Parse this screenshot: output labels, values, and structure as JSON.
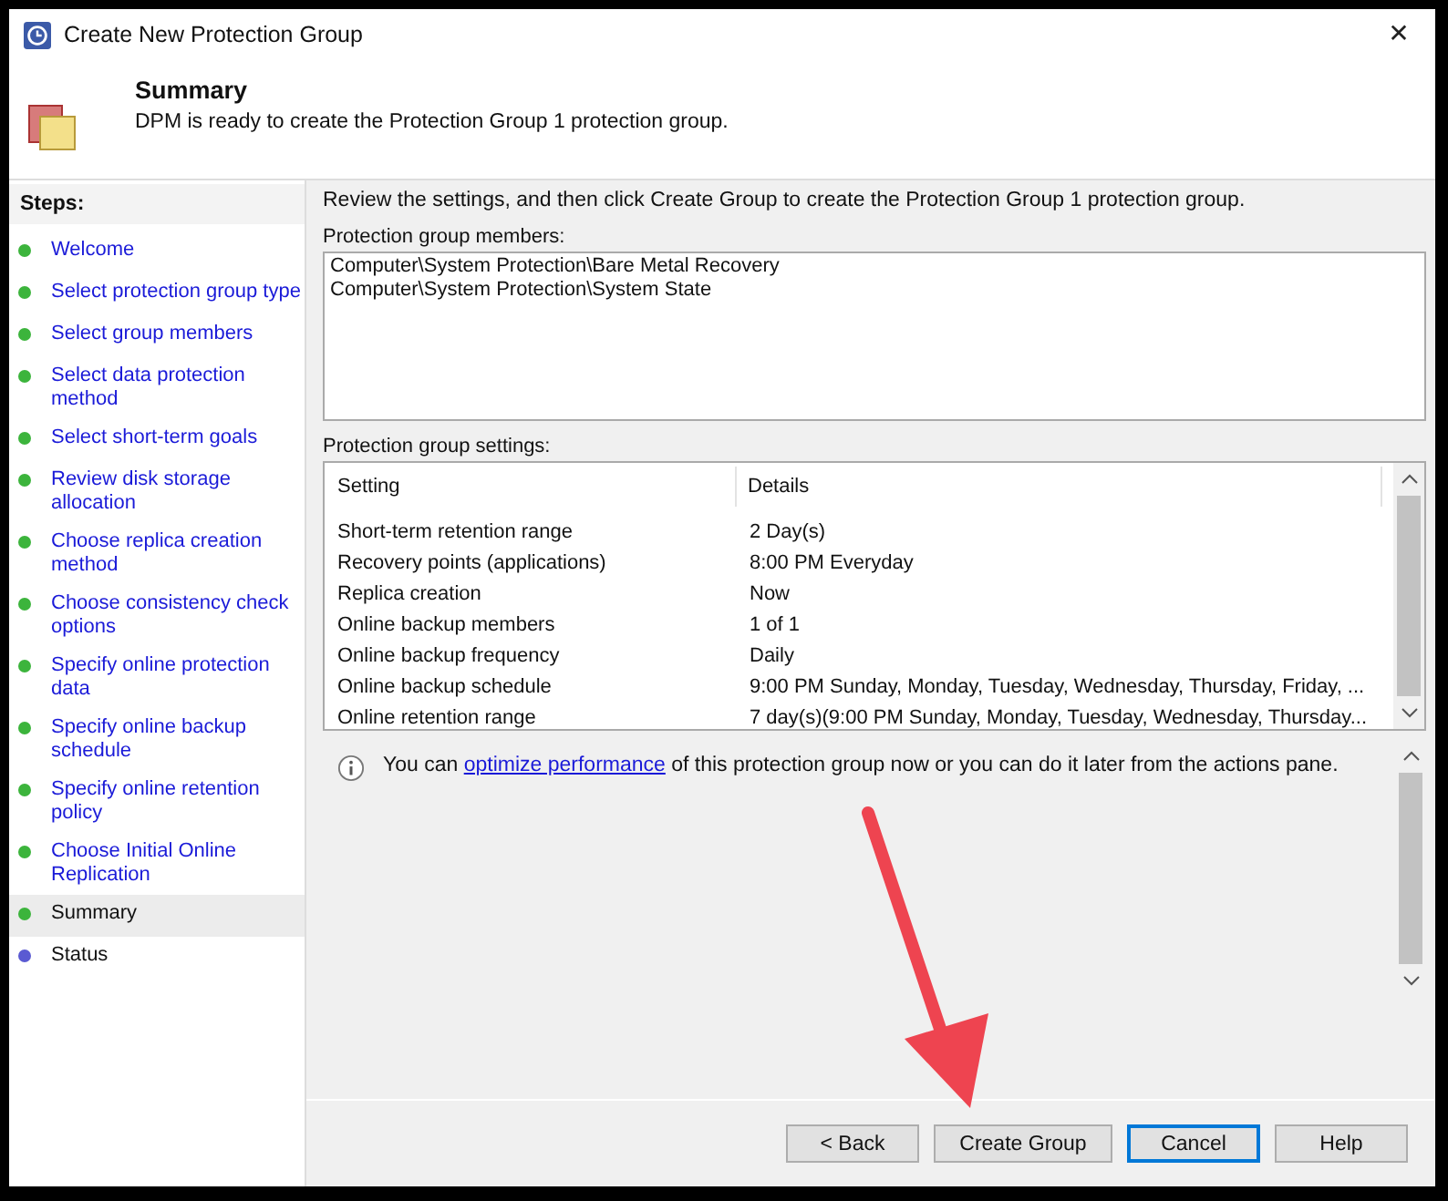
{
  "window": {
    "title": "Create New Protection Group",
    "close": "✕"
  },
  "header": {
    "title": "Summary",
    "subtitle": "DPM is ready to create the Protection Group 1 protection group."
  },
  "steps": {
    "heading": "Steps:",
    "items": [
      {
        "label": "Welcome",
        "selected": false,
        "disabled": false,
        "color": "#3cb43c"
      },
      {
        "label": "Select protection group type",
        "selected": false,
        "disabled": false,
        "color": "#3cb43c"
      },
      {
        "label": "Select group members",
        "selected": false,
        "disabled": false,
        "color": "#3cb43c"
      },
      {
        "label": "Select data protection method",
        "selected": false,
        "disabled": false,
        "color": "#3cb43c"
      },
      {
        "label": "Select short-term goals",
        "selected": false,
        "disabled": false,
        "color": "#3cb43c"
      },
      {
        "label": "Review disk storage allocation",
        "selected": false,
        "disabled": false,
        "color": "#3cb43c"
      },
      {
        "label": "Choose replica creation method",
        "selected": false,
        "disabled": false,
        "color": "#3cb43c"
      },
      {
        "label": "Choose consistency check options",
        "selected": false,
        "disabled": false,
        "color": "#3cb43c"
      },
      {
        "label": "Specify online protection data",
        "selected": false,
        "disabled": false,
        "color": "#3cb43c"
      },
      {
        "label": "Specify online backup schedule",
        "selected": false,
        "disabled": false,
        "color": "#3cb43c"
      },
      {
        "label": "Specify online retention policy",
        "selected": false,
        "disabled": false,
        "color": "#3cb43c"
      },
      {
        "label": "Choose Initial Online Replication",
        "selected": false,
        "disabled": false,
        "color": "#3cb43c"
      },
      {
        "label": "Summary",
        "selected": true,
        "disabled": false,
        "color": "#3cb43c"
      },
      {
        "label": "Status",
        "selected": false,
        "disabled": true,
        "color": "#5a5ad2"
      }
    ]
  },
  "intro": "Review the settings, and then click Create Group to create the Protection Group 1 protection group.",
  "members": {
    "label": "Protection group members:",
    "items": [
      "Computer\\System Protection\\Bare Metal Recovery",
      "Computer\\System Protection\\System State"
    ]
  },
  "settings": {
    "label": "Protection group settings:",
    "columns": [
      "Setting",
      "Details"
    ],
    "rows": [
      [
        "Short-term retention range",
        "2 Day(s)"
      ],
      [
        "Recovery points (applications)",
        "8:00 PM Everyday"
      ],
      [
        "Replica creation",
        "Now"
      ],
      [
        "Online backup members",
        "1 of 1"
      ],
      [
        "Online backup frequency",
        "Daily"
      ],
      [
        "Online backup schedule",
        "9:00 PM Sunday, Monday, Tuesday, Wednesday, Thursday, Friday, ..."
      ],
      [
        "Online retention range",
        "7 day(s)(9:00 PM Sunday, Monday, Tuesday, Wednesday, Thursday..."
      ]
    ]
  },
  "info": {
    "before": "You can ",
    "link": "optimize performance",
    "after": " of this protection group now or you can do it later from the actions pane."
  },
  "buttons": [
    {
      "label": "< Back",
      "selected": false
    },
    {
      "label": "Create Group",
      "selected": false
    },
    {
      "label": "Cancel",
      "selected": true
    },
    {
      "label": "Help",
      "selected": false
    }
  ]
}
